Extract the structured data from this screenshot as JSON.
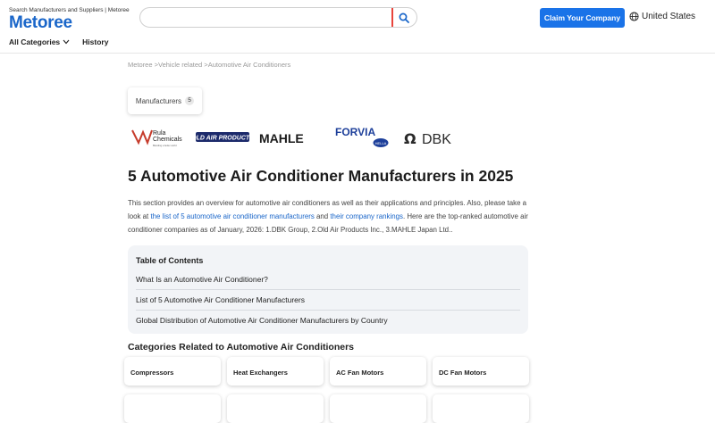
{
  "header": {
    "tagline": "Search Manufacturers and Suppliers | Metoree",
    "logo": "Metoree",
    "search": {
      "placeholder": "",
      "value": ""
    },
    "claim_button": "Claim Your Company",
    "region": "United States"
  },
  "nav": {
    "categories": "All Categories",
    "history": "History"
  },
  "breadcrumb": {
    "home": "Metoree",
    "level1": "Vehicle related",
    "level2": "Automotive Air Conditioners",
    "separator": ">"
  },
  "tab": {
    "label": "Manufacturers",
    "count": "5"
  },
  "logos": [
    {
      "name": "Rula Chemicals",
      "line1": "Rula",
      "line2": "Chemicals",
      "small": "Blending a better world"
    },
    {
      "name": "Old Air Products",
      "text": "OLD AIR PRODUCTS"
    },
    {
      "name": "MAHLE",
      "text": "MAHLE"
    },
    {
      "name": "FORVIA",
      "text": "FORVIA",
      "sub": "HELLA"
    },
    {
      "name": "DBK",
      "text": "DBK"
    }
  ],
  "title": "5 Automotive Air Conditioner Manufacturers in 2025",
  "intro": {
    "part1": "This section provides an overview for automotive air conditioners as well as their applications and principles. Also, please take a look at ",
    "link1": "the list of 5 automotive air conditioner manufacturers",
    "part2": " and ",
    "link2": "their company rankings",
    "part3": ". Here are the top-ranked automotive air conditioner companies as of January, 2026: 1.DBK Group, 2.Old Air Products Inc., 3.MAHLE Japan Ltd.."
  },
  "toc": {
    "title": "Table of Contents",
    "items": [
      "What Is an Automotive Air Conditioner?",
      "List of 5 Automotive Air Conditioner Manufacturers",
      "Global Distribution of Automotive Air Conditioner Manufacturers by Country"
    ]
  },
  "related": {
    "title": "Categories Related to Automotive Air Conditioners",
    "cards": [
      "Compressors",
      "Heat Exchangers",
      "AC Fan Motors",
      "DC Fan Motors",
      "",
      "",
      "",
      ""
    ]
  },
  "colors": {
    "brand": "#1a66c9",
    "claim_bg": "#1a73e8",
    "search_accent": "#e8443c",
    "toc_bg": "#f2f4f7"
  }
}
